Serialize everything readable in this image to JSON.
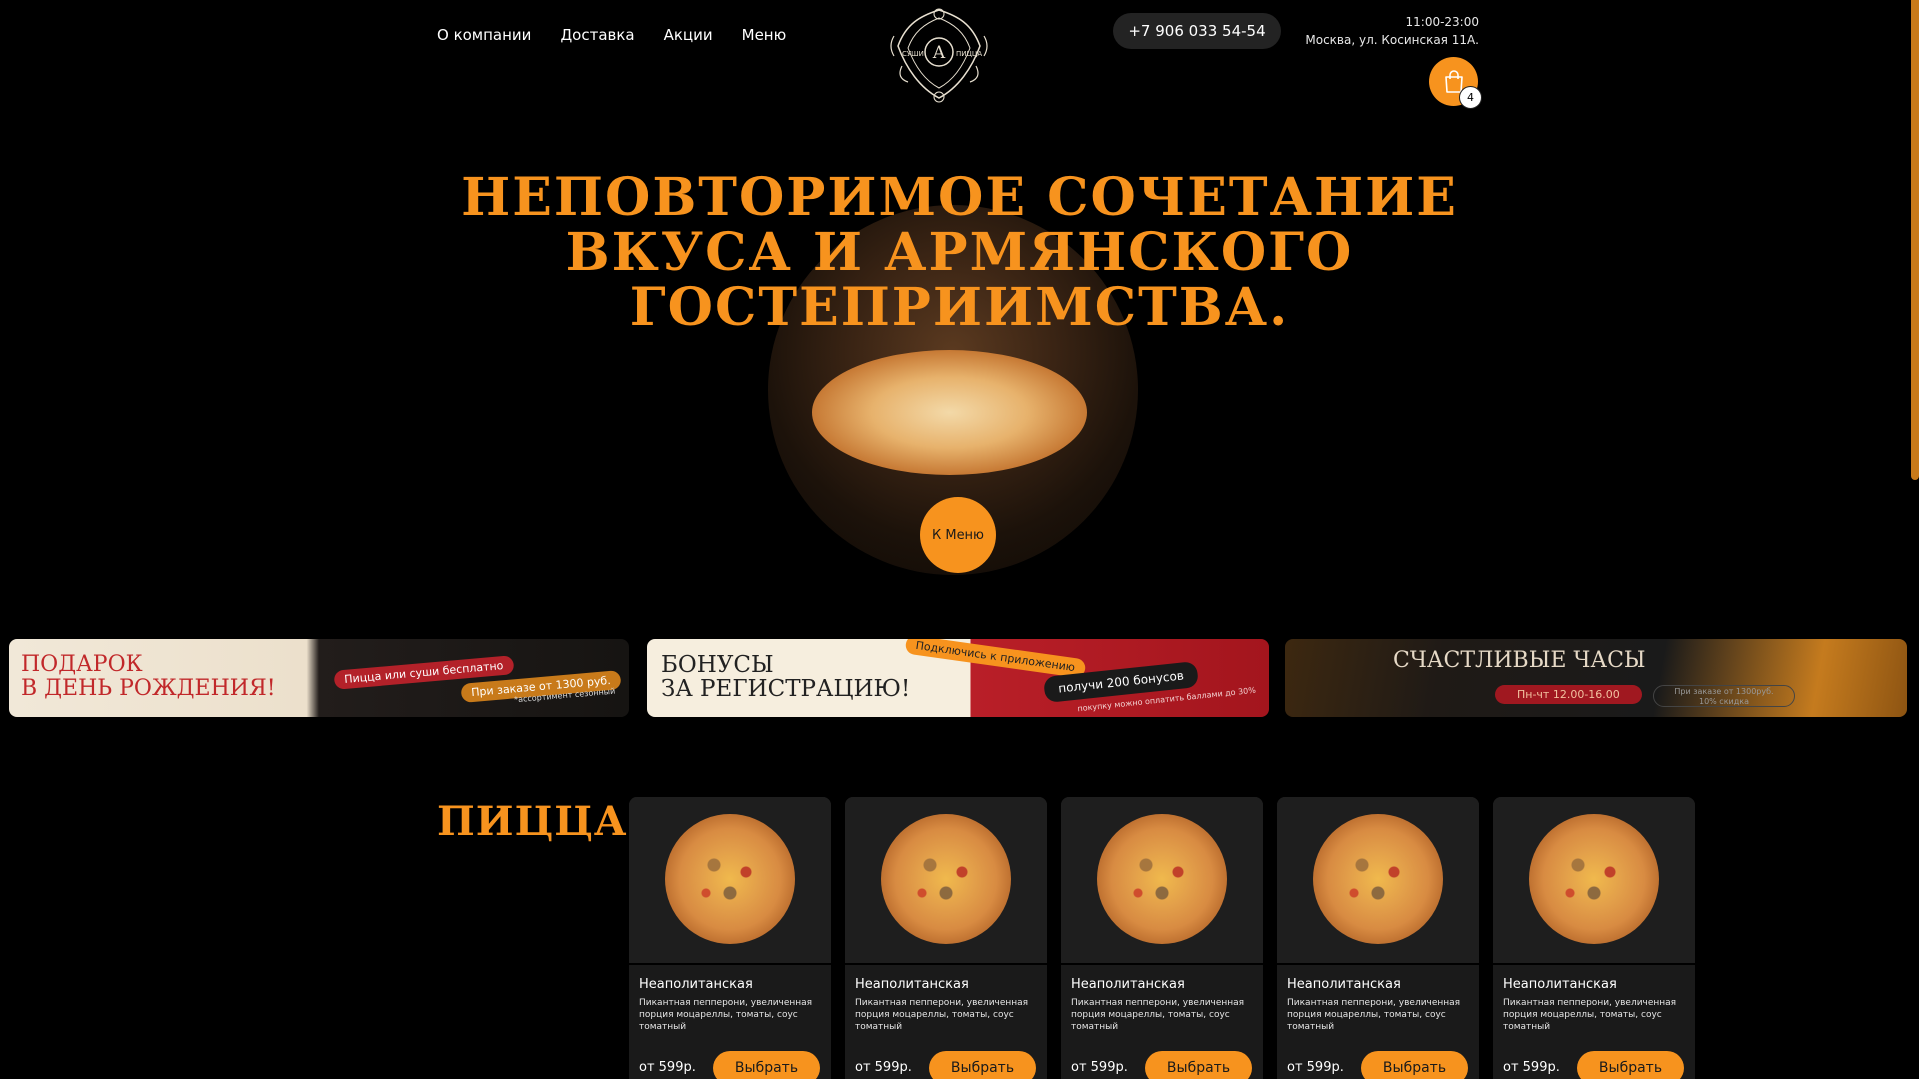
{
  "nav": {
    "items": [
      "О компании",
      "Доставка",
      "Акции",
      "Меню"
    ]
  },
  "logo": {
    "left": "СУШИ",
    "right": "ПИЦЦА",
    "mark": "A"
  },
  "contact": {
    "phone": "+7 906 033 54-54",
    "hours": "11:00-23:00",
    "address": "Москва, ул. Косинская 11А."
  },
  "cart": {
    "count": "4",
    "icon": "shopping-bag-icon"
  },
  "hero": {
    "title_line1": "Неповторимое сочетание",
    "title_line2": "вкуса и армянского",
    "title_line3": "гостеприимства.",
    "button": "К Меню"
  },
  "banners": [
    {
      "title1": "Подарок",
      "title2": "в день рождения!",
      "pill1": "Пицца или суши бесплатно",
      "pill2": "При заказе от 1300 руб.",
      "note": "*ассортимент сезонный"
    },
    {
      "title1": "Бонусы",
      "title2": "за регистрацию!",
      "pill1": "Подключись к приложению",
      "pill2": "получи 200 бонусов",
      "note": "покупку можно оплатить баллами до 30%"
    },
    {
      "title1": "Счастливые часы",
      "pill1": "Пн-чт 12.00-16.00",
      "note1": "При заказе от 1300руб.",
      "note2": "10% скидка"
    }
  ],
  "section": {
    "title": "Пицца"
  },
  "products": [
    {
      "name": "Неаполитанская",
      "desc": "Пикантная пепперони, увеличенная порция моцареллы, томаты, соус томатный",
      "price": "от 599р.",
      "button": "Выбрать"
    },
    {
      "name": "Неаполитанская",
      "desc": "Пикантная пепперони, увеличенная порция моцареллы, томаты, соус томатный",
      "price": "от 599р.",
      "button": "Выбрать"
    },
    {
      "name": "Неаполитанская",
      "desc": "Пикантная пепперони, увеличенная порция моцареллы, томаты, соус томатный",
      "price": "от 599р.",
      "button": "Выбрать"
    },
    {
      "name": "Неаполитанская",
      "desc": "Пикантная пепперони, увеличенная порция моцареллы, томаты, соус томатный",
      "price": "от 599р.",
      "button": "Выбрать"
    },
    {
      "name": "Неаполитанская",
      "desc": "Пикантная пепперони, увеличенная порция моцареллы, томаты, соус томатный",
      "price": "от 599р.",
      "button": "Выбрать"
    }
  ],
  "colors": {
    "accent": "#f7931e",
    "background": "#000000",
    "card": "#1a1a1a"
  }
}
